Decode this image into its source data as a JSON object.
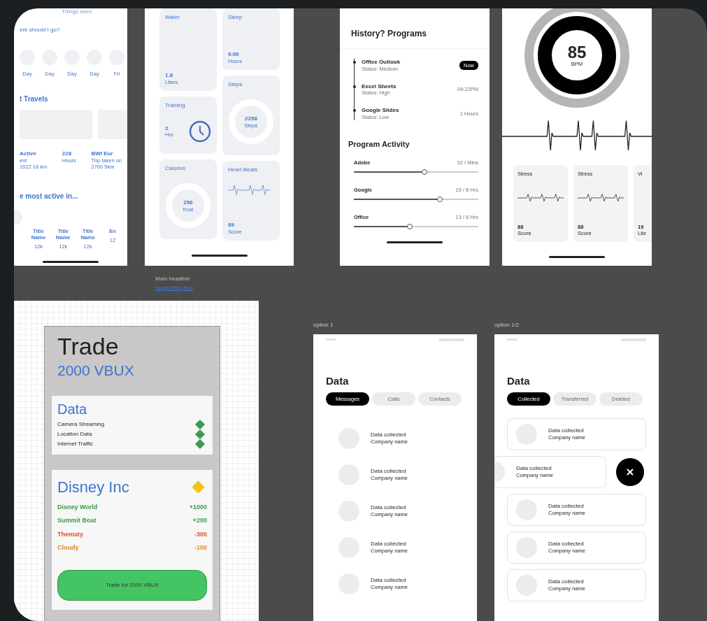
{
  "travel_screen": {
    "top_text": "Things seen",
    "question": "ere should I go?",
    "days": [
      {
        "label": "Day"
      },
      {
        "label": "Day"
      },
      {
        "label": "Day"
      },
      {
        "label": "Day"
      },
      {
        "label": "Fri"
      }
    ],
    "section_title": "t Travels",
    "stats": [
      {
        "value": "Active",
        "unit": "ent",
        "note": "2022 18 km"
      },
      {
        "value": "228",
        "unit": "Hours"
      },
      {
        "value": "BWI Eur",
        "unit": "Trip taken on",
        "note": "2700 5km"
      }
    ],
    "section2_title": "e most active in...",
    "places": [
      {
        "name": "Title Name",
        "count": "12k"
      },
      {
        "name": "Title Name",
        "count": "12k"
      },
      {
        "name": "Title Name",
        "count": "12k"
      },
      {
        "name": "En",
        "count": "12"
      }
    ]
  },
  "health_screen": {
    "columns": [
      [
        {
          "kind": "value",
          "title": "Water",
          "value": "1.8",
          "unit": "Liters"
        },
        {
          "kind": "clock",
          "title": "Training",
          "value": "2",
          "unit": "Hrs"
        },
        {
          "kind": "ring",
          "title": "Calories",
          "value": "256",
          "unit": "Kcal"
        }
      ],
      [
        {
          "kind": "value",
          "title": "Sleep",
          "value": "9.00",
          "unit": "Hours"
        },
        {
          "kind": "ring",
          "title": "Steps",
          "value": "2258",
          "unit": "Steps"
        },
        {
          "kind": "pulse",
          "title": "Heart Beats",
          "value": "89",
          "unit": "Score"
        }
      ]
    ]
  },
  "programs_screen": {
    "title": "History? Programs",
    "history": [
      {
        "name": "Office Outlook",
        "status": "Status: Medium",
        "time": "Now",
        "highlighted": true
      },
      {
        "name": "Excel Sheets",
        "status": "Status: High",
        "time": "04:22PM",
        "highlighted": false
      },
      {
        "name": "Google Slides",
        "status": "Status: Low",
        "time": "1 Hours",
        "highlighted": false
      }
    ],
    "activity_title": "Program Activity",
    "activity": [
      {
        "name": "Adobe",
        "reading": "32 / Mins",
        "level": 0.57
      },
      {
        "name": "Google",
        "reading": "15 / 8 Hrs",
        "level": 0.69
      },
      {
        "name": "Office",
        "reading": "13 / 8 Hrs",
        "level": 0.45
      }
    ]
  },
  "heart_screen": {
    "value": "85",
    "unit": "BPM",
    "cards": [
      {
        "title": "Stress",
        "value": "88",
        "unit": "Score"
      },
      {
        "title": "Stress",
        "value": "88",
        "unit": "Score"
      },
      {
        "title": "Vi",
        "value": "19",
        "unit": "Lite"
      }
    ]
  },
  "frame_label": {
    "title": "Main headline",
    "link": "Supporting text"
  },
  "trade_screen": {
    "title": "Trade",
    "amount": "2000 VBUX",
    "data_title": "Data",
    "data_items": [
      {
        "name": "Camera Streaming",
        "color": "#3d9a4e"
      },
      {
        "name": "Location Data",
        "color": "#3d9a4e"
      },
      {
        "name": "Internet Traffic",
        "color": "#3d9a4e"
      }
    ],
    "company": {
      "name": "Disney Inc",
      "color": "#f2c21b"
    },
    "changes": [
      {
        "name": "Disney World",
        "value": "+1000",
        "color": "#3a9a4a"
      },
      {
        "name": "Summit Boat",
        "value": "+200",
        "color": "#3a9a4a"
      },
      {
        "name": "Thematy",
        "value": "-300",
        "color": "#d9552c"
      },
      {
        "name": "Cloudy",
        "value": "-100",
        "color": "#e0892c"
      }
    ],
    "button": "Trade for 2000 VBUX"
  },
  "data_screens": [
    {
      "label": "option 1",
      "title": "Data",
      "kind": "plain",
      "chips": [
        {
          "label": "Messages",
          "selected": true
        },
        {
          "label": "Calls",
          "selected": false
        },
        {
          "label": "Contacts",
          "selected": false
        }
      ],
      "items": [
        {
          "title": "Data collected",
          "subtitle": "Company name"
        },
        {
          "title": "Data collected",
          "subtitle": "Company name"
        },
        {
          "title": "Data collected",
          "subtitle": "Company name"
        },
        {
          "title": "Data collected",
          "subtitle": "Company name"
        },
        {
          "title": "Data collected",
          "subtitle": "Company name"
        }
      ]
    },
    {
      "label": "option 1/2",
      "title": "Data",
      "kind": "cards",
      "chips": [
        {
          "label": "Collected",
          "selected": true
        },
        {
          "label": "Transferred",
          "selected": false
        },
        {
          "label": "Deleted",
          "selected": false
        }
      ],
      "items": [
        {
          "title": "Data collected",
          "subtitle": "Company name",
          "swiped": false
        },
        {
          "title": "Data collected",
          "subtitle": "Company name",
          "swiped": true
        },
        {
          "title": "Data collected",
          "subtitle": "Company name",
          "swiped": false
        },
        {
          "title": "Data collected",
          "subtitle": "Company name",
          "swiped": false
        },
        {
          "title": "Data collected",
          "subtitle": "Company name",
          "swiped": false
        }
      ]
    }
  ]
}
